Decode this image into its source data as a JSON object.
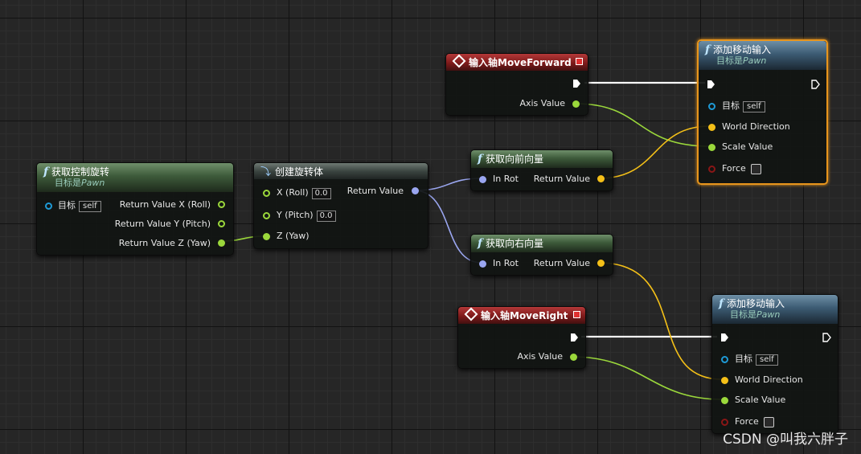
{
  "nodes": {
    "get_control_rotation": {
      "title": "获取控制旋转",
      "subtitle_prefix": "目标是",
      "subtitle_target": "Pawn",
      "target_label": "目标",
      "self_label": "self",
      "out_x": "Return Value X (Roll)",
      "out_y": "Return Value Y (Pitch)",
      "out_z": "Return Value Z (Yaw)"
    },
    "make_rotator": {
      "title": "创建旋转体",
      "x_label": "X (Roll)",
      "x_value": "0.0",
      "y_label": "Y (Pitch)",
      "y_value": "0.0",
      "z_label": "Z (Yaw)",
      "return_label": "Return Value"
    },
    "axis_forward": {
      "title": "输入轴MoveForward",
      "axis_value_label": "Axis Value"
    },
    "get_forward": {
      "title": "获取向前向量",
      "in_label": "In Rot",
      "return_label": "Return Value"
    },
    "get_right": {
      "title": "获取向右向量",
      "in_label": "In Rot",
      "return_label": "Return Value"
    },
    "axis_right": {
      "title": "输入轴MoveRight",
      "axis_value_label": "Axis Value"
    },
    "add_move_1": {
      "title": "添加移动输入",
      "subtitle_prefix": "目标是",
      "subtitle_target": "Pawn",
      "target_label": "目标",
      "self_label": "self",
      "world_direction": "World Direction",
      "scale_value": "Scale Value",
      "force": "Force"
    },
    "add_move_2": {
      "title": "添加移动输入",
      "subtitle_prefix": "目标是",
      "subtitle_target": "Pawn",
      "target_label": "目标",
      "self_label": "self",
      "world_direction": "World Direction",
      "scale_value": "Scale Value",
      "force": "Force"
    }
  },
  "icons": {
    "function": "function-icon",
    "event": "input-axis-event-icon",
    "rotator": "make-rotator-icon",
    "exec": "exec-pin-icon"
  },
  "colors": {
    "float_pin": "#9bd83b",
    "rotator_pin": "#9aa6f0",
    "vector_pin": "#f4c018",
    "object_pin": "#1e9ad6",
    "bool_pin": "#8a1616",
    "selection": "#e8951c",
    "exec_wire": "#ffffff"
  },
  "watermark": "CSDN @叫我六胖子"
}
